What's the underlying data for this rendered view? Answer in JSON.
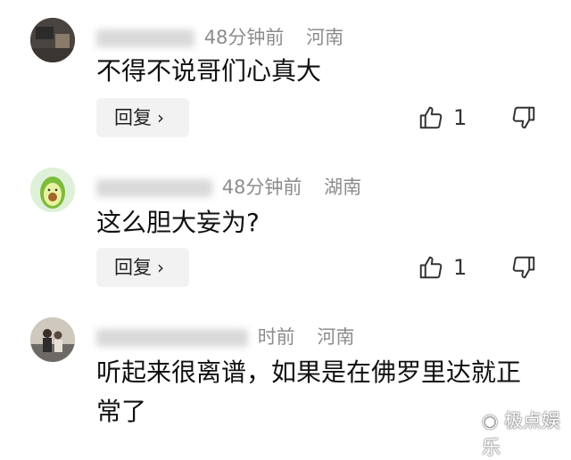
{
  "comments": [
    {
      "time": "48分钟前",
      "location": "河南",
      "text": "不得不说哥们心真大",
      "reply_label": "回复",
      "likes": "1"
    },
    {
      "time": "48分钟前",
      "location": "湖南",
      "text": "这么胆大妄为?",
      "reply_label": "回复",
      "likes": "1"
    },
    {
      "time": "时前",
      "location": "河南",
      "text": "听起来很离谱，如果是在佛罗里达就正常了"
    }
  ],
  "watermark": "极点娱乐",
  "icons": [
    "thumbs-up-icon",
    "thumbs-down-icon",
    "chevron-right-icon",
    "weibo-icon"
  ]
}
